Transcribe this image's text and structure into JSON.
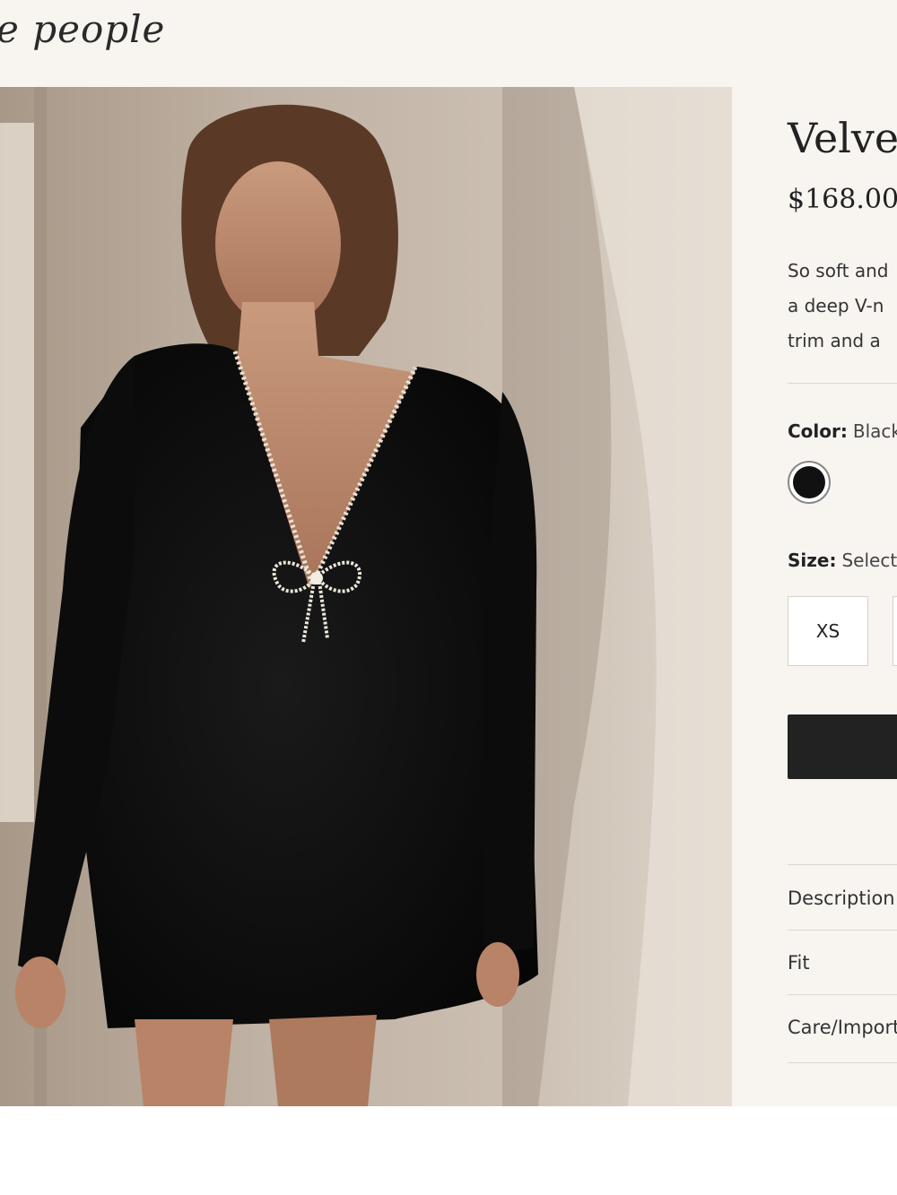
{
  "header": {
    "logo_text": "e people"
  },
  "product": {
    "title": "Velvet",
    "price": "$168.00",
    "description_lines": [
      "So soft and",
      "a deep V-n",
      "trim and a"
    ],
    "color_label": "Color:",
    "color_value": "Black",
    "size_label": "Size:",
    "size_value": "Select",
    "sizes": [
      "XS",
      ""
    ],
    "accordion": [
      "Description",
      "Fit",
      "Care/Import"
    ]
  },
  "colors": {
    "panel_bg": "#f8f5f1",
    "swatch": "#111111",
    "button": "#222222",
    "divider": "#dad6d0"
  }
}
